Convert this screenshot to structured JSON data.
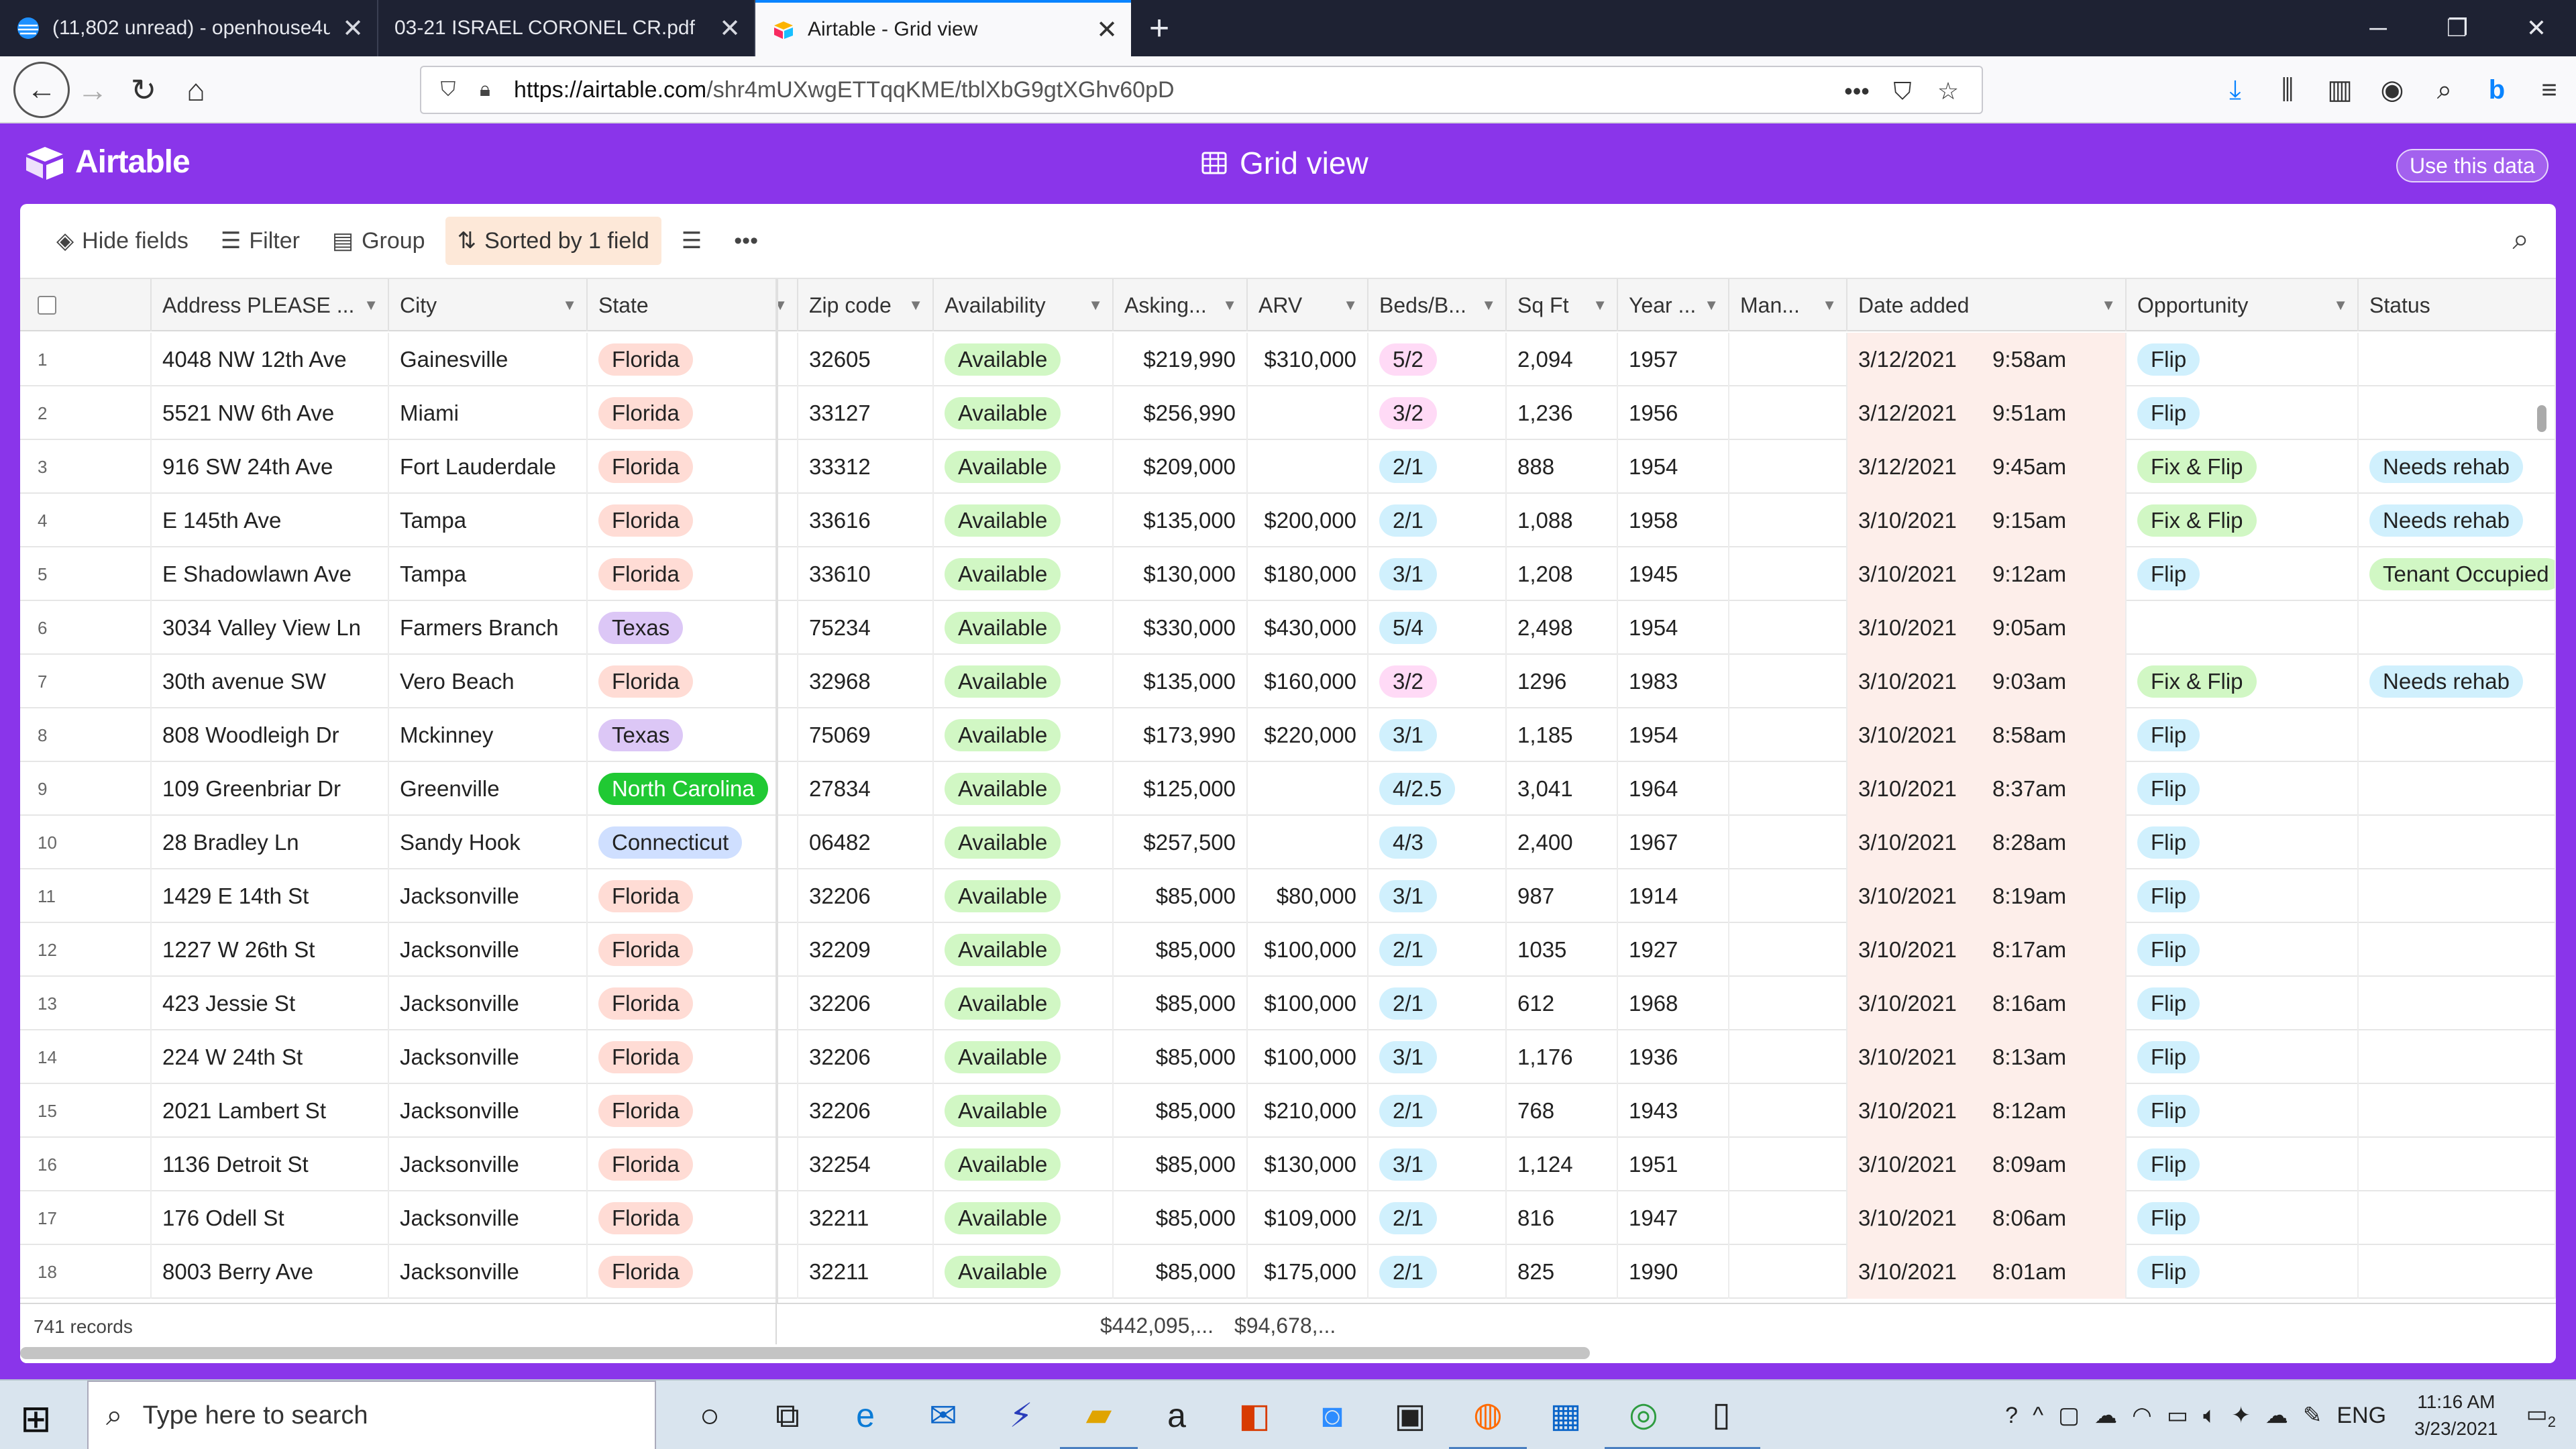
{
  "browser": {
    "tabs": [
      {
        "title": "(11,802 unread) - openhouse4u",
        "active": false
      },
      {
        "title": "03-21 ISRAEL CORONEL CR.pdf",
        "active": false
      },
      {
        "title": "Airtable - Grid view",
        "active": true
      }
    ],
    "url_host": "https://airtable.com",
    "url_path": "/shr4mUXwgETTqqKME/tblXbG9gtXGhv60pD"
  },
  "app": {
    "logo_text": "Airtable",
    "view_title": "Grid view",
    "use_data_label": "Use this data"
  },
  "toolbar": {
    "hide_fields": "Hide fields",
    "filter": "Filter",
    "group": "Group",
    "sorted": "Sorted by 1 field"
  },
  "columns": [
    "Address PLEASE ...",
    "City",
    "State",
    "Zip code",
    "Availability",
    "Asking...",
    "ARV",
    "Beds/B...",
    "Sq Ft",
    "Year ...",
    "Man...",
    "Date added",
    "Opportunity",
    "Status"
  ],
  "rows": [
    {
      "n": "1",
      "address": "4048 NW 12th Ave",
      "city": "Gainesville",
      "state": "Florida",
      "zip": "32605",
      "avail": "Available",
      "asking": "$219,990",
      "arv": "$310,000",
      "beds": "5/2",
      "sqft": "2,094",
      "year": "1957",
      "date": "3/12/2021",
      "time": "9:58am",
      "opp": "Flip",
      "status": ""
    },
    {
      "n": "2",
      "address": "5521 NW 6th Ave",
      "city": "Miami",
      "state": "Florida",
      "zip": "33127",
      "avail": "Available",
      "asking": "$256,990",
      "arv": "",
      "beds": "3/2",
      "sqft": "1,236",
      "year": "1956",
      "date": "3/12/2021",
      "time": "9:51am",
      "opp": "Flip",
      "status": ""
    },
    {
      "n": "3",
      "address": "916 SW 24th Ave",
      "city": "Fort Lauderdale",
      "state": "Florida",
      "zip": "33312",
      "avail": "Available",
      "asking": "$209,000",
      "arv": "",
      "beds": "2/1",
      "sqft": "888",
      "year": "1954",
      "date": "3/12/2021",
      "time": "9:45am",
      "opp": "Fix & Flip",
      "status": "Needs rehab"
    },
    {
      "n": "4",
      "address": "E 145th Ave",
      "city": "Tampa",
      "state": "Florida",
      "zip": "33616",
      "avail": "Available",
      "asking": "$135,000",
      "arv": "$200,000",
      "beds": "2/1",
      "sqft": "1,088",
      "year": "1958",
      "date": "3/10/2021",
      "time": "9:15am",
      "opp": "Fix & Flip",
      "status": "Needs rehab"
    },
    {
      "n": "5",
      "address": "E Shadowlawn Ave",
      "city": "Tampa",
      "state": "Florida",
      "zip": "33610",
      "avail": "Available",
      "asking": "$130,000",
      "arv": "$180,000",
      "beds": "3/1",
      "sqft": "1,208",
      "year": "1945",
      "date": "3/10/2021",
      "time": "9:12am",
      "opp": "Flip",
      "status": "Tenant Occupied"
    },
    {
      "n": "6",
      "address": "3034 Valley View Ln",
      "city": "Farmers Branch",
      "state": "Texas",
      "zip": "75234",
      "avail": "Available",
      "asking": "$330,000",
      "arv": "$430,000",
      "beds": "5/4",
      "sqft": "2,498",
      "year": "1954",
      "date": "3/10/2021",
      "time": "9:05am",
      "opp": "",
      "status": ""
    },
    {
      "n": "7",
      "address": "30th avenue SW",
      "city": "Vero Beach",
      "state": "Florida",
      "zip": "32968",
      "avail": "Available",
      "asking": "$135,000",
      "arv": "$160,000",
      "beds": "3/2",
      "sqft": "1296",
      "year": "1983",
      "date": "3/10/2021",
      "time": "9:03am",
      "opp": "Fix & Flip",
      "status": "Needs rehab"
    },
    {
      "n": "8",
      "address": "808 Woodleigh Dr",
      "city": "Mckinney",
      "state": "Texas",
      "zip": "75069",
      "avail": "Available",
      "asking": "$173,990",
      "arv": "$220,000",
      "beds": "3/1",
      "sqft": "1,185",
      "year": "1954",
      "date": "3/10/2021",
      "time": "8:58am",
      "opp": "Flip",
      "status": ""
    },
    {
      "n": "9",
      "address": "109 Greenbriar Dr",
      "city": "Greenville",
      "state": "North Carolina",
      "zip": "27834",
      "avail": "Available",
      "asking": "$125,000",
      "arv": "",
      "beds": "4/2.5",
      "sqft": "3,041",
      "year": "1964",
      "date": "3/10/2021",
      "time": "8:37am",
      "opp": "Flip",
      "status": ""
    },
    {
      "n": "10",
      "address": "28 Bradley Ln",
      "city": "Sandy Hook",
      "state": "Connecticut",
      "zip": "06482",
      "avail": "Available",
      "asking": "$257,500",
      "arv": "",
      "beds": "4/3",
      "sqft": "2,400",
      "year": "1967",
      "date": "3/10/2021",
      "time": "8:28am",
      "opp": "Flip",
      "status": ""
    },
    {
      "n": "11",
      "address": "1429 E 14th St",
      "city": "Jacksonville",
      "state": "Florida",
      "zip": "32206",
      "avail": "Available",
      "asking": "$85,000",
      "arv": "$80,000",
      "beds": "3/1",
      "sqft": "987",
      "year": "1914",
      "date": "3/10/2021",
      "time": "8:19am",
      "opp": "Flip",
      "status": ""
    },
    {
      "n": "12",
      "address": "1227 W 26th St",
      "city": "Jacksonville",
      "state": "Florida",
      "zip": "32209",
      "avail": "Available",
      "asking": "$85,000",
      "arv": "$100,000",
      "beds": "2/1",
      "sqft": "1035",
      "year": "1927",
      "date": "3/10/2021",
      "time": "8:17am",
      "opp": "Flip",
      "status": ""
    },
    {
      "n": "13",
      "address": "423 Jessie St",
      "city": "Jacksonville",
      "state": "Florida",
      "zip": "32206",
      "avail": "Available",
      "asking": "$85,000",
      "arv": "$100,000",
      "beds": "2/1",
      "sqft": "612",
      "year": "1968",
      "date": "3/10/2021",
      "time": "8:16am",
      "opp": "Flip",
      "status": ""
    },
    {
      "n": "14",
      "address": "224 W 24th St",
      "city": "Jacksonville",
      "state": "Florida",
      "zip": "32206",
      "avail": "Available",
      "asking": "$85,000",
      "arv": "$100,000",
      "beds": "3/1",
      "sqft": "1,176",
      "year": "1936",
      "date": "3/10/2021",
      "time": "8:13am",
      "opp": "Flip",
      "status": ""
    },
    {
      "n": "15",
      "address": "2021 Lambert St",
      "city": "Jacksonville",
      "state": "Florida",
      "zip": "32206",
      "avail": "Available",
      "asking": "$85,000",
      "arv": "$210,000",
      "beds": "2/1",
      "sqft": "768",
      "year": "1943",
      "date": "3/10/2021",
      "time": "8:12am",
      "opp": "Flip",
      "status": ""
    },
    {
      "n": "16",
      "address": "1136 Detroit St",
      "city": "Jacksonville",
      "state": "Florida",
      "zip": "32254",
      "avail": "Available",
      "asking": "$85,000",
      "arv": "$130,000",
      "beds": "3/1",
      "sqft": "1,124",
      "year": "1951",
      "date": "3/10/2021",
      "time": "8:09am",
      "opp": "Flip",
      "status": ""
    },
    {
      "n": "17",
      "address": "176 Odell St",
      "city": "Jacksonville",
      "state": "Florida",
      "zip": "32211",
      "avail": "Available",
      "asking": "$85,000",
      "arv": "$109,000",
      "beds": "2/1",
      "sqft": "816",
      "year": "1947",
      "date": "3/10/2021",
      "time": "8:06am",
      "opp": "Flip",
      "status": ""
    },
    {
      "n": "18",
      "address": "8003 Berry Ave",
      "city": "Jacksonville",
      "state": "Florida",
      "zip": "32211",
      "avail": "Available",
      "asking": "$85,000",
      "arv": "$175,000",
      "beds": "2/1",
      "sqft": "825",
      "year": "1990",
      "date": "3/10/2021",
      "time": "8:01am",
      "opp": "Flip",
      "status": ""
    }
  ],
  "footer": {
    "records": "741 records",
    "sum_asking": "$442,095,...",
    "sum_arv": "$94,678,..."
  },
  "taskbar": {
    "search_placeholder": "Type here to search",
    "lang": "ENG",
    "time": "11:16 AM",
    "date": "3/23/2021",
    "notifications": "2"
  },
  "colors": {
    "brand": "#8a35ea",
    "tab_bg": "#1e2233",
    "taskbar_bg": "#d9e4ee"
  }
}
